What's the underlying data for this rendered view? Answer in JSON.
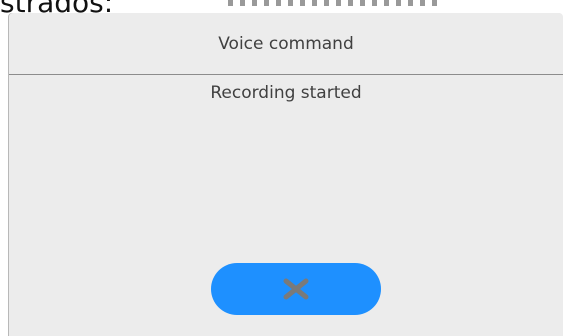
{
  "background": {
    "partial_text": "strados:"
  },
  "dialog": {
    "title": "Voice command",
    "message": "Recording started",
    "cancel_icon": "close-icon"
  },
  "colors": {
    "dialog_background": "#ececec",
    "button_accent": "#1e90ff",
    "icon_color": "#7a7a7a",
    "text_color": "#404040"
  }
}
